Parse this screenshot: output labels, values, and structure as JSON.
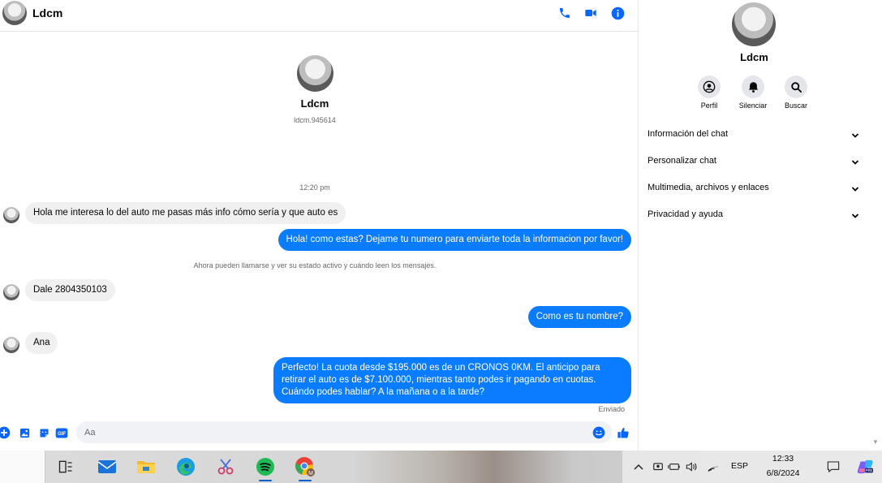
{
  "header": {
    "contact_name": "Ldcm"
  },
  "profile": {
    "name": "Ldcm",
    "username": "ldcm.945614"
  },
  "conversation": {
    "timestamp": "12:20 pm",
    "notice": "Ahora pueden llamarse y ver su estado activo y cuándo leen los mensajes.",
    "messages": [
      {
        "direction": "incoming",
        "text": "Hola me interesa lo del auto me pasas más info  cómo sería y que auto es"
      },
      {
        "direction": "outgoing",
        "text": "Hola! como estas? Dejame tu numero para enviarte toda la informacion por favor!"
      },
      {
        "direction": "incoming",
        "text": "Dale 2804350103"
      },
      {
        "direction": "outgoing",
        "text": "Como es tu nombre?"
      },
      {
        "direction": "incoming",
        "text": "Ana"
      },
      {
        "direction": "outgoing",
        "text": "Perfecto! La cuota desde $195.000 es de un CRONOS 0KM. El anticipo para retirar el auto es de $7.100.000, mientras tanto podes ir pagando en cuotas. Cuándo podes hablar? A la mañana o a la tarde?"
      }
    ],
    "sent_status": "Enviado"
  },
  "composer": {
    "placeholder": "Aa",
    "gif_label": "GIF"
  },
  "info_panel": {
    "name": "Ldcm",
    "actions": [
      {
        "label": "Perfil",
        "icon": "profile-icon"
      },
      {
        "label": "Silenciar",
        "icon": "bell-icon"
      },
      {
        "label": "Buscar",
        "icon": "search-icon"
      }
    ],
    "sections": [
      "Información del chat",
      "Personalizar chat",
      "Multimedia, archivos y enlaces",
      "Privacidad y ayuda"
    ]
  },
  "taskbar": {
    "language": "ESP",
    "time": "12:33",
    "date": "6/8/2024",
    "copilot_badge": "PRE"
  },
  "colors": {
    "accent": "#0a7cff",
    "bubble_incoming": "#f0f0f0",
    "icon_blue": "#0866ff"
  }
}
